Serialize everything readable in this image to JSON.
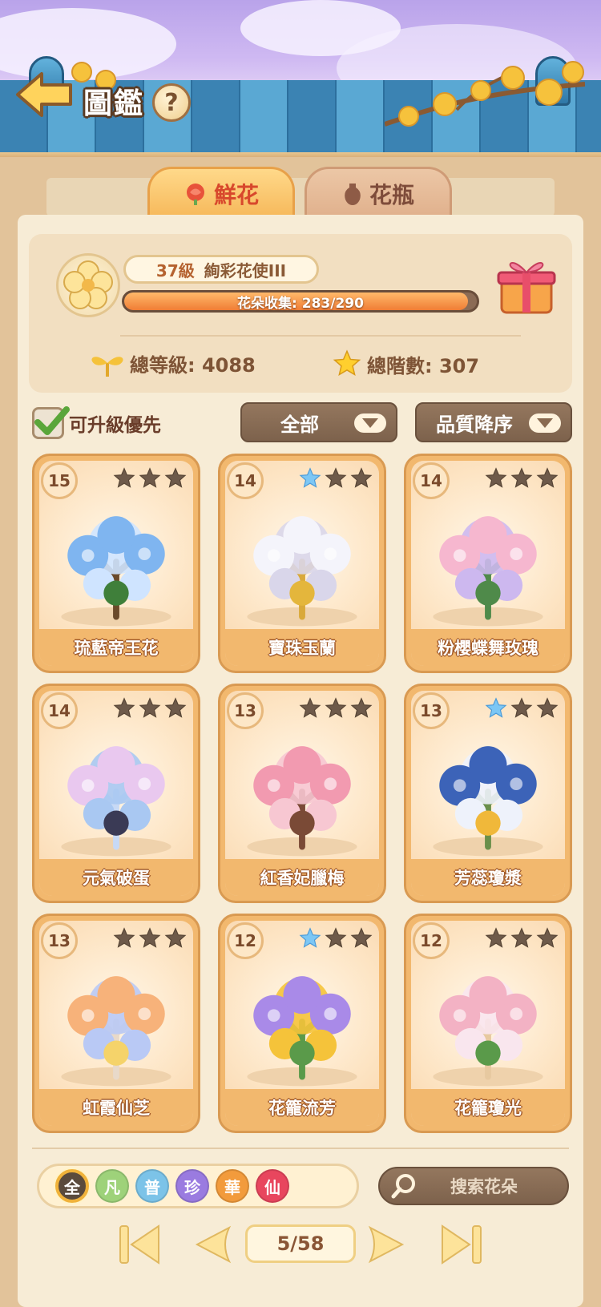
{
  "header": {
    "title": "圖鑑",
    "help_label": "?"
  },
  "tabs": [
    {
      "label": "鮮花",
      "active": true
    },
    {
      "label": "花瓶",
      "active": false
    }
  ],
  "stats": {
    "level": "37級",
    "rank_title": "絢彩花使III",
    "collection_text": "花朵收集: 283/290",
    "collection_progress": 0.976,
    "total_level_label": "總等級: 4088",
    "total_tier_label": "總階數: 307"
  },
  "filters": {
    "upgrade_first_label": "可升級優先",
    "upgrade_first_checked": true,
    "category": "全部",
    "sort": "品質降序"
  },
  "cards": [
    {
      "level": "15",
      "name": "琉藍帝王花",
      "stars_blue": 0,
      "theme": "blue"
    },
    {
      "level": "14",
      "name": "寶珠玉蘭",
      "stars_blue": 1,
      "theme": "white"
    },
    {
      "level": "14",
      "name": "粉櫻蝶舞玫瑰",
      "stars_blue": 0,
      "theme": "pink"
    },
    {
      "level": "14",
      "name": "元氣破蛋",
      "stars_blue": 0,
      "theme": "snow"
    },
    {
      "level": "13",
      "name": "紅香妃臘梅",
      "stars_blue": 0,
      "theme": "plum"
    },
    {
      "level": "13",
      "name": "芳蕊瓊漿",
      "stars_blue": 1,
      "theme": "porcelain"
    },
    {
      "level": "13",
      "name": "虹霞仙芝",
      "stars_blue": 0,
      "theme": "mushroom"
    },
    {
      "level": "12",
      "name": "花籠流芳",
      "stars_blue": 1,
      "theme": "cage"
    },
    {
      "level": "12",
      "name": "花籠瓊光",
      "stars_blue": 0,
      "theme": "cage2"
    }
  ],
  "rarity_filters": [
    {
      "label": "全",
      "color": "#5a4a3c",
      "selected": true
    },
    {
      "label": "凡",
      "color": "#9ed27a",
      "selected": false
    },
    {
      "label": "普",
      "color": "#7cc3e8",
      "selected": false
    },
    {
      "label": "珍",
      "color": "#9a7be0",
      "selected": false
    },
    {
      "label": "華",
      "color": "#f29b3c",
      "selected": false
    },
    {
      "label": "仙",
      "color": "#e8465e",
      "selected": false
    }
  ],
  "search": {
    "placeholder": "搜索花朵"
  },
  "pagination": {
    "text": "5/58"
  },
  "colors": {
    "accent": "#f2b86e",
    "panel": "#f7ecd6",
    "dark_button": "#85694f"
  }
}
